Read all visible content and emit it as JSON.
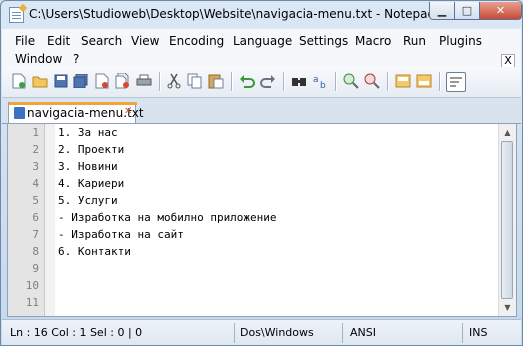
{
  "window": {
    "title": "C:\\Users\\Studioweb\\Desktop\\Website\\navigacia-menu.txt - Notepad++",
    "controls": {
      "minimize": "▁",
      "maximize": "□",
      "close": "✕"
    }
  },
  "menu": {
    "items": [
      "File",
      "Edit",
      "Search",
      "View",
      "Encoding",
      "Language",
      "Settings",
      "Macro",
      "Run",
      "Plugins",
      "Window",
      "?"
    ],
    "close_glyph": "X"
  },
  "toolbar": {
    "icons": [
      "new-file-icon",
      "open-file-icon",
      "save-icon",
      "save-all-icon",
      "close-icon",
      "close-all-icon",
      "print-icon",
      "cut-icon",
      "copy-icon",
      "paste-icon",
      "undo-icon",
      "redo-icon",
      "find-icon",
      "replace-icon",
      "zoom-in-icon",
      "zoom-out-icon",
      "sync-v-icon",
      "sync-h-icon",
      "wrap-icon"
    ]
  },
  "tab": {
    "label": "navigacia-menu.txt",
    "close": "✕"
  },
  "editor": {
    "line_numbers": [
      "1",
      "2",
      "3",
      "4",
      "5",
      "6",
      "7",
      "8",
      "9",
      "10",
      "11"
    ],
    "lines": [
      "1. За нас",
      "2. Проекти",
      "3. Новини",
      "4. Кариери",
      "5. Услуги",
      "- Изработка на мобилно приложение",
      "- Изработка на сайт",
      "6. Контакти",
      "",
      "",
      ""
    ]
  },
  "statusbar": {
    "position": "Ln : 16    Col : 1    Sel : 0 | 0",
    "eol": "Dos\\Windows",
    "encoding": "ANSI",
    "mode": "INS"
  },
  "colors": {
    "accent_tab": "#f2a43a",
    "gutter": "#e4e4e4",
    "line_number": "#808080"
  }
}
